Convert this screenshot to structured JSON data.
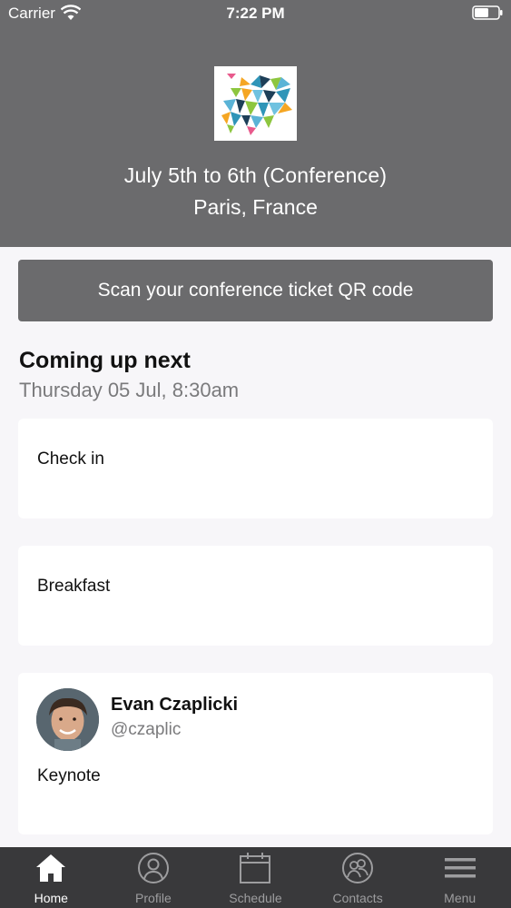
{
  "status_bar": {
    "carrier": "Carrier",
    "time": "7:22 PM"
  },
  "event": {
    "dates": "July 5th to 6th (Conference)",
    "location": "Paris, France"
  },
  "scan": {
    "label": "Scan your conference ticket QR code"
  },
  "upcoming": {
    "title": "Coming up next",
    "datetime": "Thursday 05 Jul, 8:30am",
    "items": [
      {
        "label": "Check in"
      },
      {
        "label": "Breakfast"
      },
      {
        "label": "Keynote",
        "speaker_name": "Evan Czaplicki",
        "speaker_handle": "@czaplic"
      }
    ]
  },
  "tabs": [
    {
      "label": "Home",
      "icon": "home-icon",
      "active": true
    },
    {
      "label": "Profile",
      "icon": "profile-icon",
      "active": false
    },
    {
      "label": "Schedule",
      "icon": "calendar-icon",
      "active": false
    },
    {
      "label": "Contacts",
      "icon": "contacts-icon",
      "active": false
    },
    {
      "label": "Menu",
      "icon": "menu-icon",
      "active": false
    }
  ],
  "colors": {
    "header_bg": "#6b6b6d",
    "tab_bar_bg": "#39393b",
    "page_bg": "#f7f6f9"
  }
}
